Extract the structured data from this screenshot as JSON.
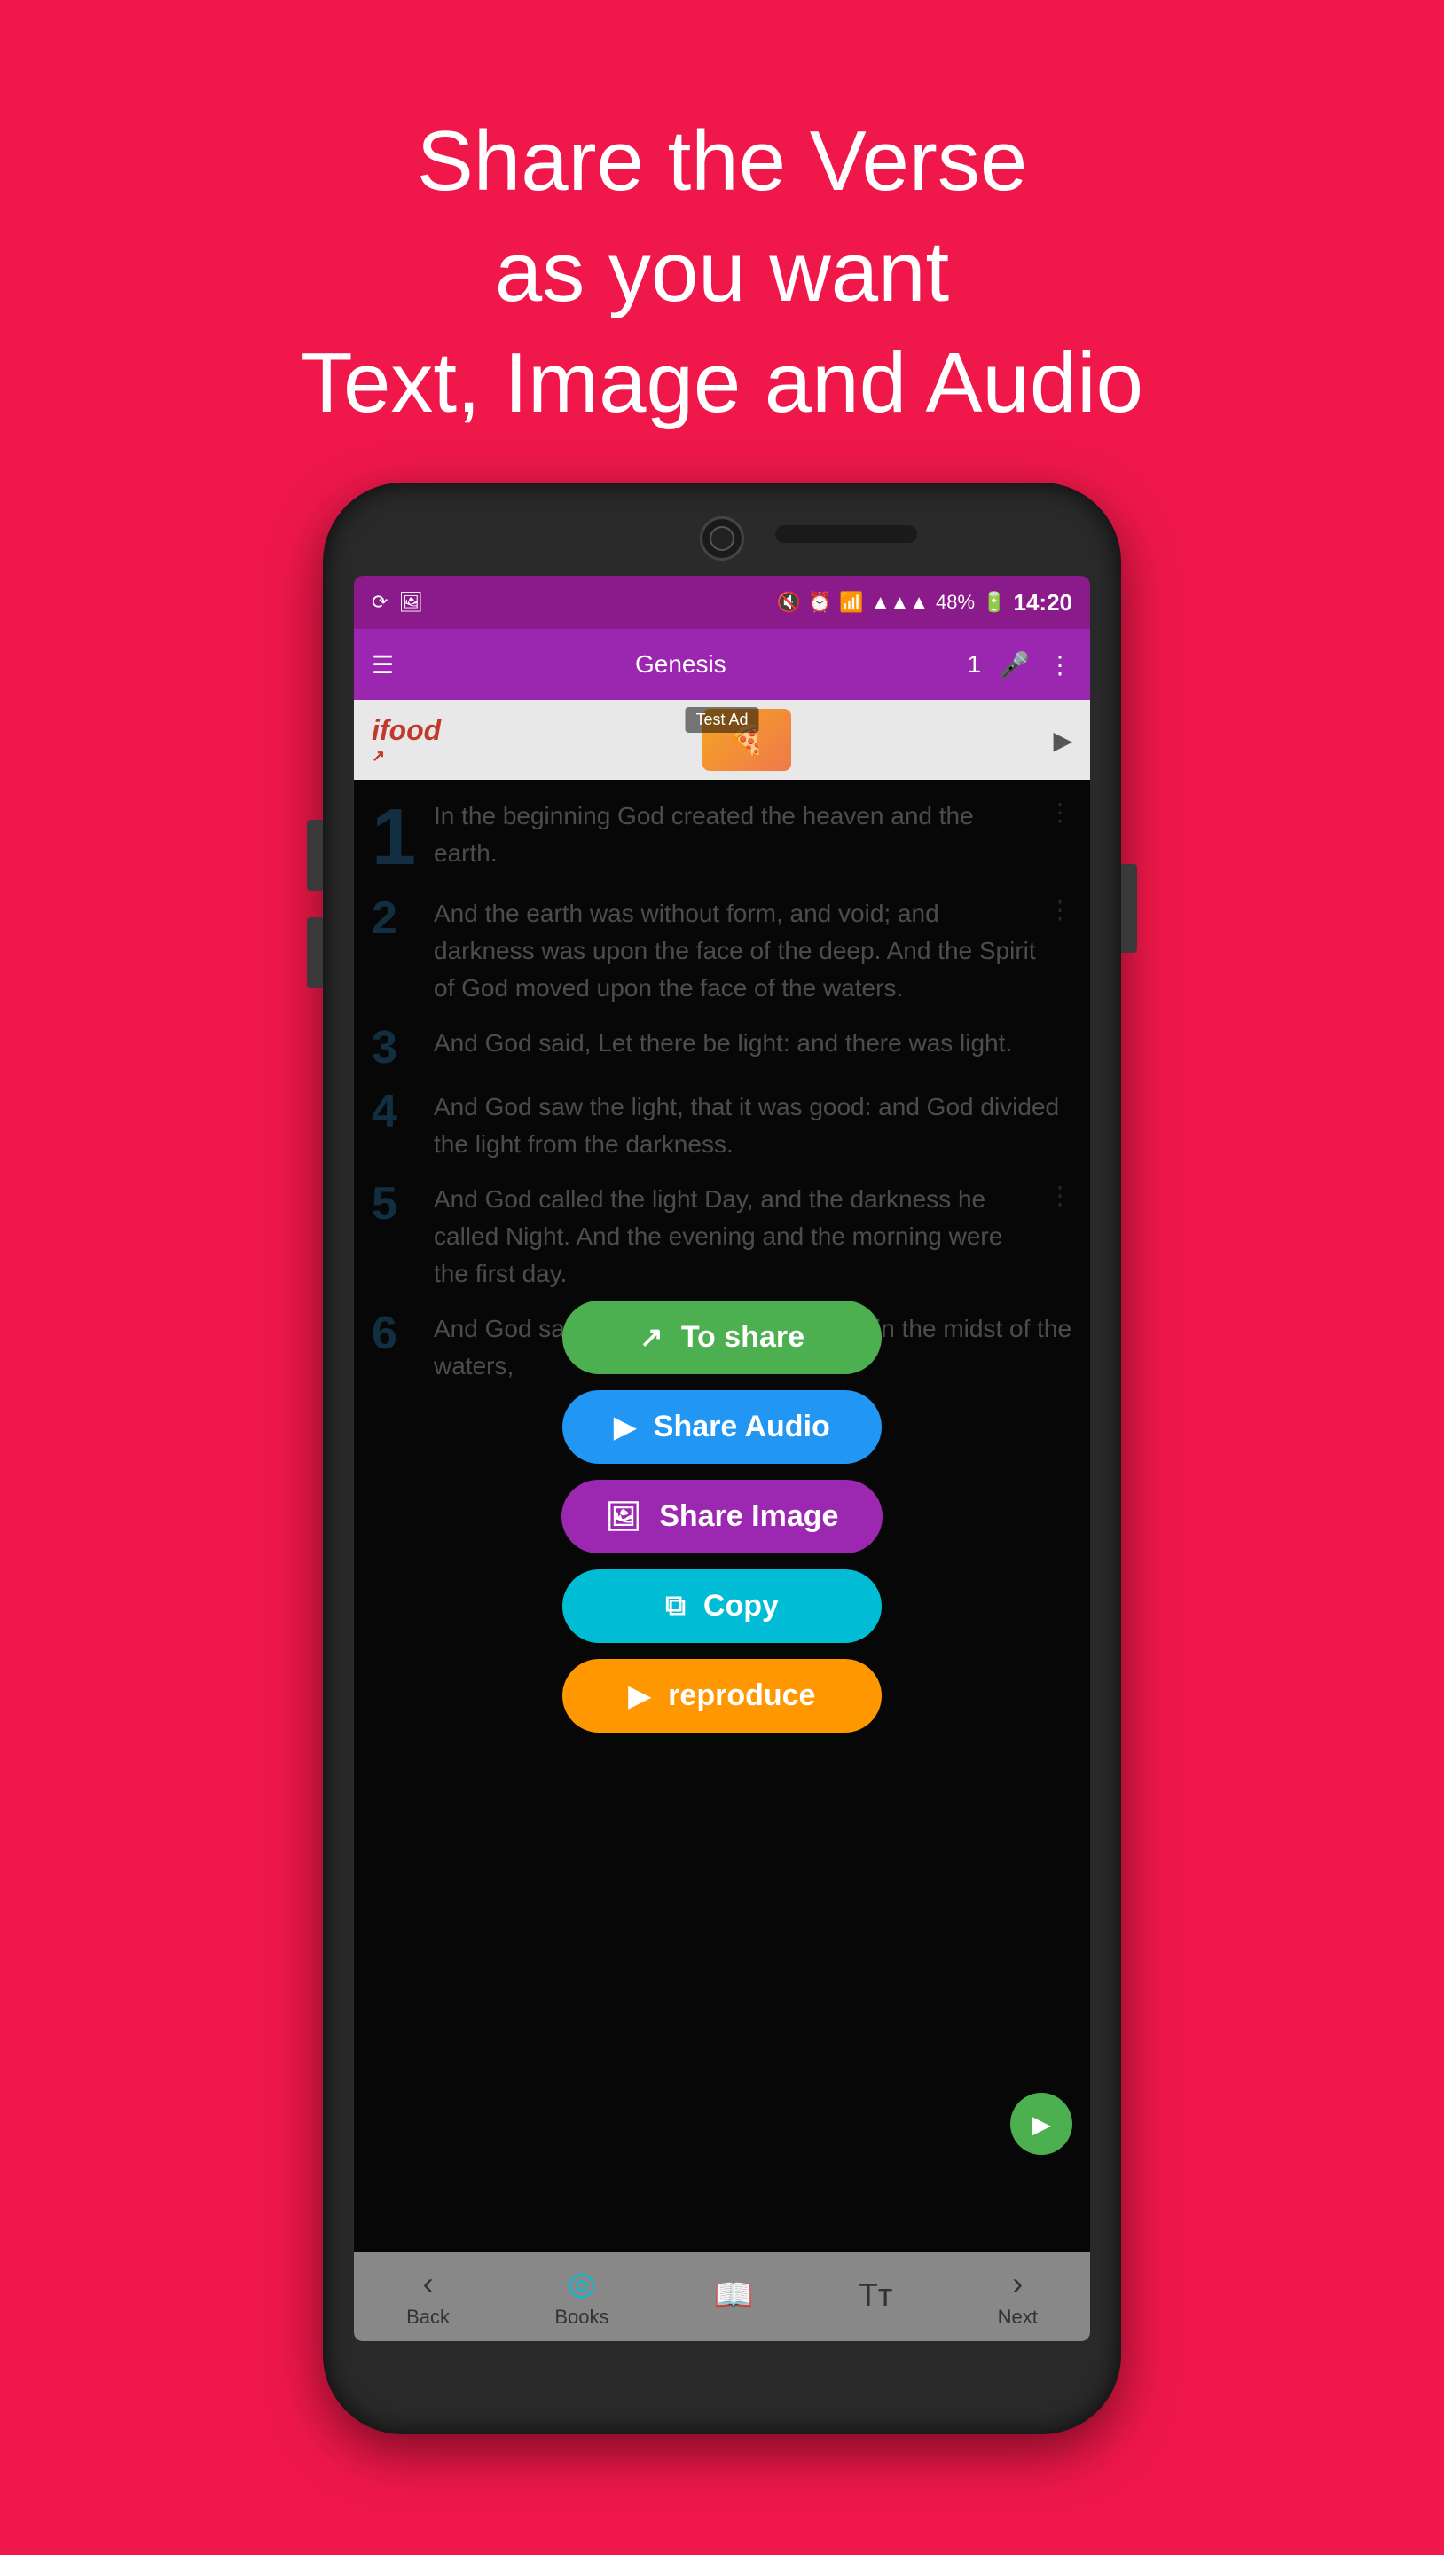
{
  "header": {
    "line1": "Share the Verse",
    "line2": "as you want",
    "line3": "Text, Image and Audio"
  },
  "status_bar": {
    "time": "14:20",
    "battery": "48%",
    "signal": "▲▲▲▲",
    "wifi": "WiFi",
    "mute": "🔇",
    "alarm": "⏰"
  },
  "app_bar": {
    "title": "Genesis",
    "chapter": "1"
  },
  "ad": {
    "brand": "ifood",
    "test_label": "Test Ad"
  },
  "verses": [
    {
      "number": "1",
      "text": "In the beginning God created the heaven and the earth.",
      "large": true
    },
    {
      "number": "2",
      "text": "And the earth was without form, and void; and darkness was upon the face of the deep. And the Spirit of God moved upon the face of the waters.",
      "large": false
    },
    {
      "number": "3",
      "text": "And God said, Let there be light: and there was light.",
      "large": false
    },
    {
      "number": "4",
      "text": "And God saw the light, that it was good: and God divided the light from the darkness.",
      "large": false
    },
    {
      "number": "5",
      "text": "And God called the light Day, and the darkness he called Night. And the evening and the morning were the first day.",
      "large": false
    },
    {
      "number": "6",
      "text": "And God said, Let there be a firmament in the midst of the waters,",
      "large": false
    }
  ],
  "popup": {
    "btn_toshare": "To share",
    "btn_audio": "Share Audio",
    "btn_image": "Share Image",
    "btn_copy": "Copy",
    "btn_reproduce": "reproduce"
  },
  "bottom_nav": {
    "back_label": "Back",
    "books_label": "Books",
    "next_label": "Next"
  },
  "page_next": "Next"
}
